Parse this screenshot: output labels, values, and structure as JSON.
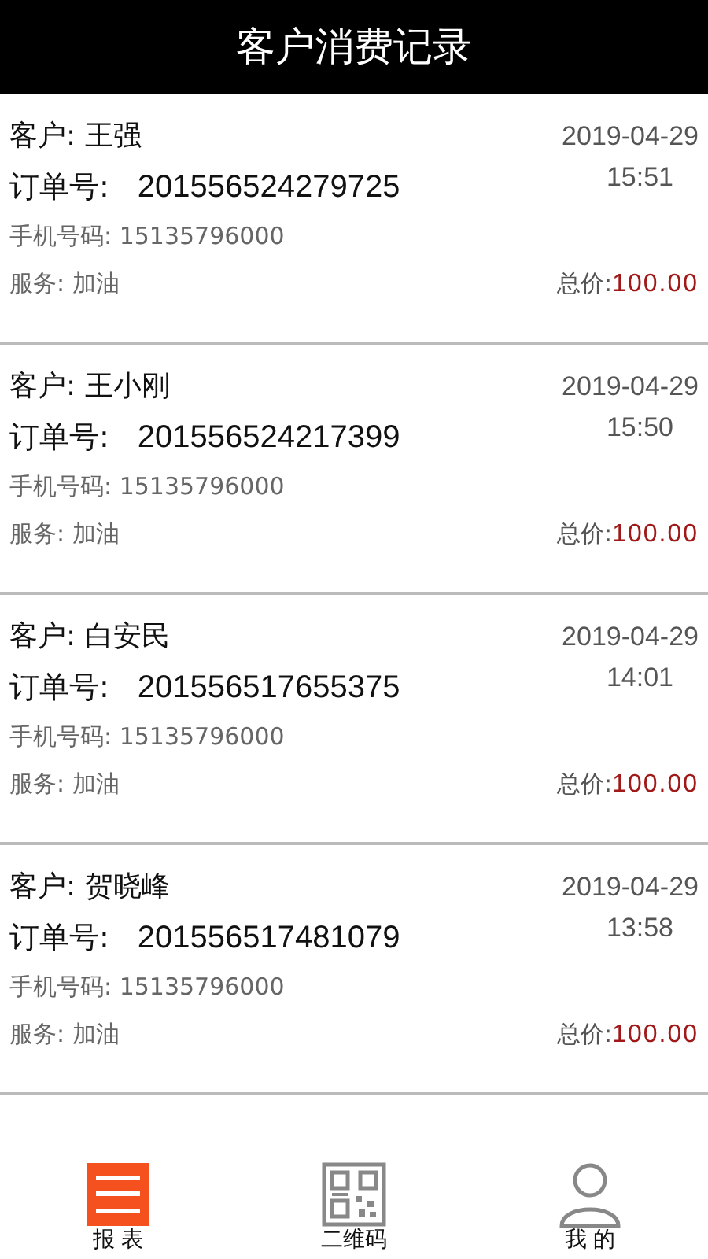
{
  "header": {
    "title": "客户消费记录"
  },
  "records": [
    {
      "customer": "客户: 王强",
      "order": "订单号:",
      "order_no": "201556524279725",
      "phone": "手机号码: 15135796000",
      "service": "服务: 加油",
      "date": "2019-04-29",
      "time": "15:51",
      "total_label": "总价:",
      "total": "100.00"
    },
    {
      "customer": "客户: 王小刚",
      "order": "订单号:",
      "order_no": "201556524217399",
      "phone": "手机号码: 15135796000",
      "service": "服务: 加油",
      "date": "2019-04-29",
      "time": "15:50",
      "total_label": "总价:",
      "total": "100.00"
    },
    {
      "customer": "客户: 白安民",
      "order": "订单号:",
      "order_no": "201556517655375",
      "phone": "手机号码: 15135796000",
      "service": "服务: 加油",
      "date": "2019-04-29",
      "time": "14:01",
      "total_label": "总价:",
      "total": "100.00"
    },
    {
      "customer": "客户: 贺晓峰",
      "order": "订单号:",
      "order_no": "201556517481079",
      "phone": "手机号码: 15135796000",
      "service": "服务: 加油",
      "date": "2019-04-29",
      "time": "13:58",
      "total_label": "总价:",
      "total": "100.00"
    }
  ],
  "tabs": [
    {
      "kind": "report",
      "label": "报 表",
      "selected": true
    },
    {
      "kind": "qrcode",
      "label": "二维码",
      "selected": false
    },
    {
      "kind": "profile",
      "label": "我 的",
      "selected": false
    }
  ]
}
